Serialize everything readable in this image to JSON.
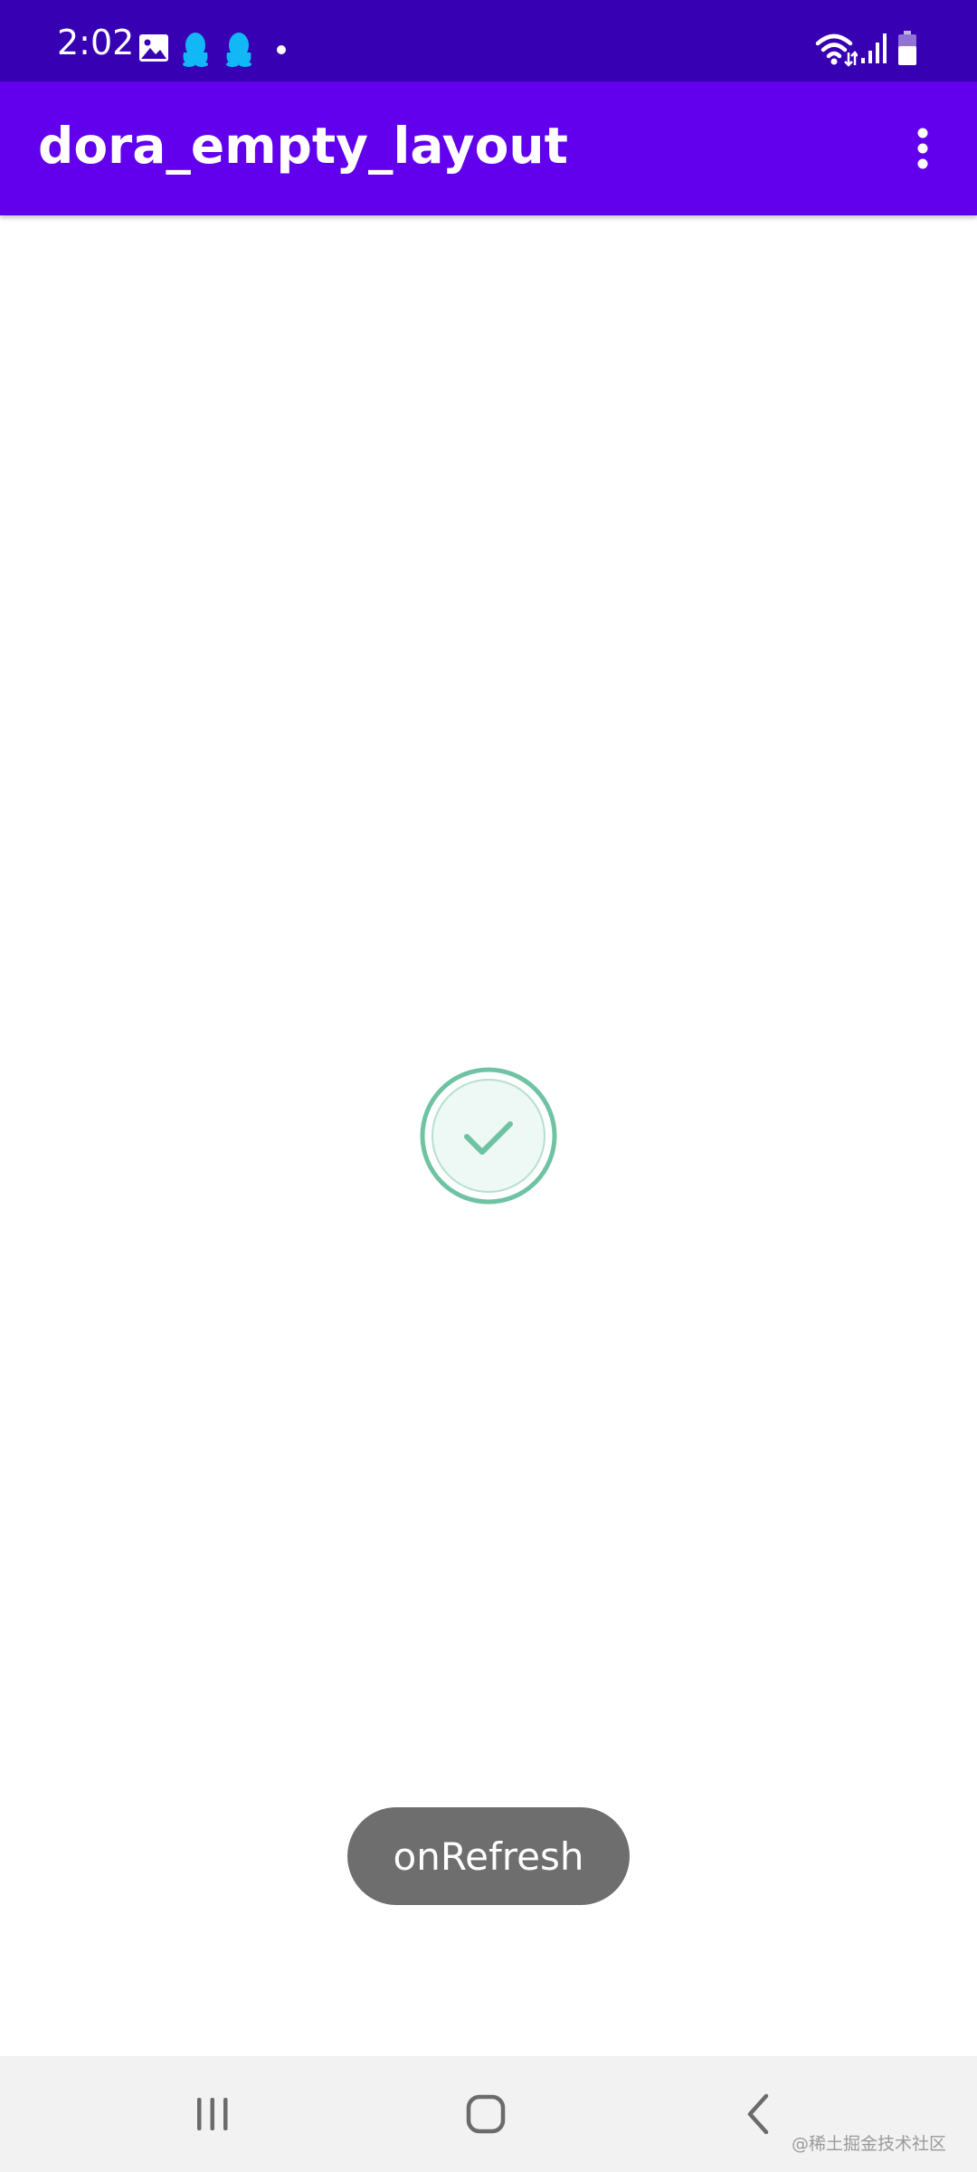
{
  "status_bar": {
    "time": "2:02",
    "notification_icons": [
      "image-icon",
      "qq-icon",
      "qq-icon",
      "dot-icon"
    ],
    "system_icons": [
      "wifi-icon",
      "signal-icon",
      "battery-icon"
    ],
    "colors": {
      "background": "#3700b3",
      "qq": "#12b7f5"
    }
  },
  "app_bar": {
    "title": "dora_empty_layout",
    "overflow_icon": "more-vert-icon",
    "background": "#6200ee"
  },
  "content": {
    "state_icon": "check-circle-icon",
    "state_color": "#6ec3a2"
  },
  "toast": {
    "text": "onRefresh"
  },
  "nav_bar": {
    "buttons": [
      "recents-icon",
      "home-icon",
      "back-icon"
    ],
    "watermark": "@稀土掘金技术社区"
  }
}
